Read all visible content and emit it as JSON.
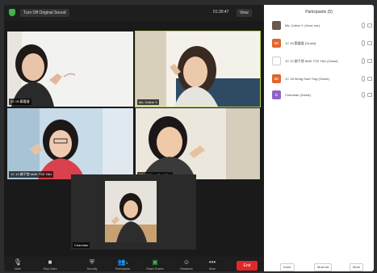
{
  "topbar": {
    "original_sound_label": "Turn Off Original Sound",
    "timer": "01:30:47",
    "view_label": "View"
  },
  "tiles": [
    {
      "name": "1C 05 鄭嘉瑩"
    },
    {
      "name": "Ms. Celine Y."
    },
    {
      "name": "1C 10 謝子悠 MAK TSZ YAU"
    },
    {
      "name": "1C 18 Wong Suet Ying"
    },
    {
      "name": "Charmian"
    }
  ],
  "controls": {
    "mute": "Mute",
    "video": "Stop Video",
    "security": "Security",
    "participants": "Participants",
    "participants_count": "5",
    "share": "Share Screen",
    "reactions": "Reactions",
    "more": "More",
    "end": "End"
  },
  "panel": {
    "title": "Participants (5)",
    "participants": [
      {
        "initials": "",
        "name": "Ms. Celine Y. (Host, me)",
        "color": "#6b5a4a"
      },
      {
        "initials": "1C",
        "name": "1C 05 鄭嘉瑩 (Guest)",
        "color": "#e2632b"
      },
      {
        "initials": "",
        "name": "1C 10 謝子悠 MAK TSZ YAU (Guest)",
        "color": "#ffffff"
      },
      {
        "initials": "1C",
        "name": "1C 18 Wong Suet Ying (Guest)",
        "color": "#e2632b"
      },
      {
        "initials": "C",
        "name": "Charmian (Guest)",
        "color": "#8e62c9"
      }
    ],
    "invite": "Invite",
    "mute_all": "Mute All",
    "more": "More"
  }
}
